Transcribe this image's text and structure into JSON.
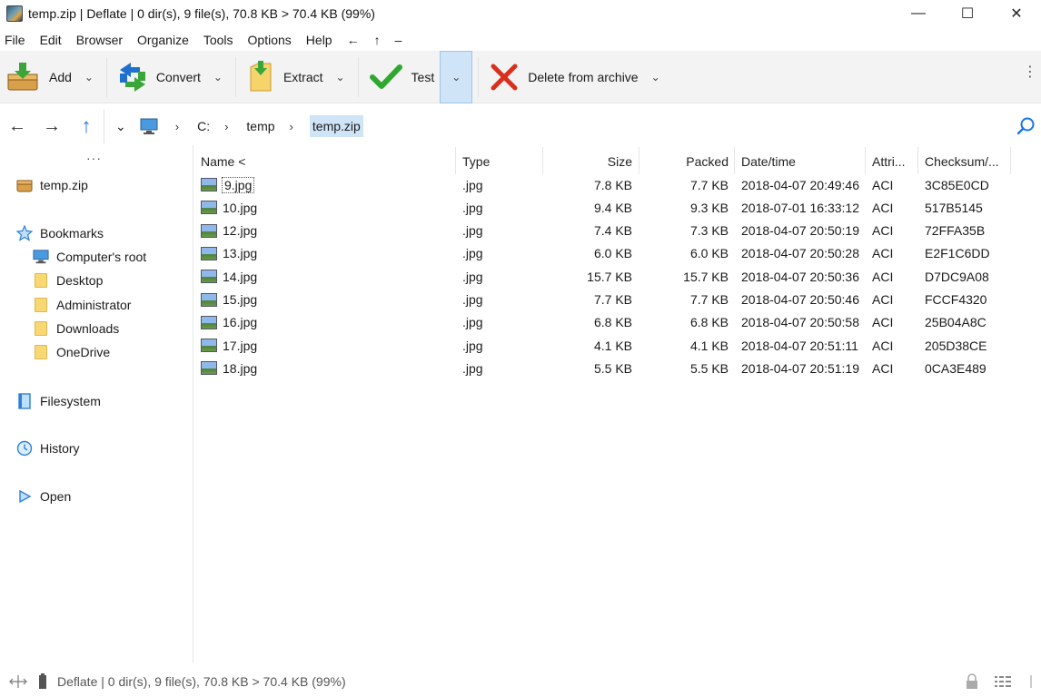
{
  "window": {
    "title": "temp.zip | Deflate | 0 dir(s), 9 file(s), 70.8 KB > 70.4 KB (99%)",
    "minimize": "—",
    "maximize": "☐",
    "close": "✕"
  },
  "menu": {
    "items": [
      "File",
      "Edit",
      "Browser",
      "Organize",
      "Tools",
      "Options",
      "Help",
      "←",
      "↑",
      "–"
    ]
  },
  "toolbar": {
    "add": "Add",
    "convert": "Convert",
    "extract": "Extract",
    "test": "Test",
    "delete": "Delete from archive",
    "dropdown": "⌄",
    "more": "⋮"
  },
  "address": {
    "back": "←",
    "forward": "→",
    "up": "↑",
    "history_dropdown": "⌄",
    "crumbs": [
      "C:",
      "temp",
      "temp.zip"
    ],
    "separator": "›"
  },
  "sidebar": {
    "dots": "···",
    "archive": "temp.zip",
    "bookmarks": "Bookmarks",
    "bookmark_items": [
      "Computer's root",
      "Desktop",
      "Administrator",
      "Downloads",
      "OneDrive"
    ],
    "filesystem": "Filesystem",
    "history": "History",
    "open": "Open"
  },
  "columns": {
    "name": "Name <",
    "type": "Type",
    "size": "Size",
    "packed": "Packed",
    "datetime": "Date/time",
    "attrib": "Attri...",
    "checksum": "Checksum/..."
  },
  "files": [
    {
      "name": "9.jpg",
      "type": ".jpg",
      "size": "7.8 KB",
      "packed": "7.7 KB",
      "datetime": "2018-04-07 20:49:46",
      "attrib": "ACI",
      "checksum": "3C85E0CD"
    },
    {
      "name": "10.jpg",
      "type": ".jpg",
      "size": "9.4 KB",
      "packed": "9.3 KB",
      "datetime": "2018-07-01 16:33:12",
      "attrib": "ACI",
      "checksum": "517B5145"
    },
    {
      "name": "12.jpg",
      "type": ".jpg",
      "size": "7.4 KB",
      "packed": "7.3 KB",
      "datetime": "2018-04-07 20:50:19",
      "attrib": "ACI",
      "checksum": "72FFA35B"
    },
    {
      "name": "13.jpg",
      "type": ".jpg",
      "size": "6.0 KB",
      "packed": "6.0 KB",
      "datetime": "2018-04-07 20:50:28",
      "attrib": "ACI",
      "checksum": "E2F1C6DD"
    },
    {
      "name": "14.jpg",
      "type": ".jpg",
      "size": "15.7 KB",
      "packed": "15.7 KB",
      "datetime": "2018-04-07 20:50:36",
      "attrib": "ACI",
      "checksum": "D7DC9A08"
    },
    {
      "name": "15.jpg",
      "type": ".jpg",
      "size": "7.7 KB",
      "packed": "7.7 KB",
      "datetime": "2018-04-07 20:50:46",
      "attrib": "ACI",
      "checksum": "FCCF4320"
    },
    {
      "name": "16.jpg",
      "type": ".jpg",
      "size": "6.8 KB",
      "packed": "6.8 KB",
      "datetime": "2018-04-07 20:50:58",
      "attrib": "ACI",
      "checksum": "25B04A8C"
    },
    {
      "name": "17.jpg",
      "type": ".jpg",
      "size": "4.1 KB",
      "packed": "4.1 KB",
      "datetime": "2018-04-07 20:51:11",
      "attrib": "ACI",
      "checksum": "205D38CE"
    },
    {
      "name": "18.jpg",
      "type": ".jpg",
      "size": "5.5 KB",
      "packed": "5.5 KB",
      "datetime": "2018-04-07 20:51:19",
      "attrib": "ACI",
      "checksum": "0CA3E489"
    }
  ],
  "status": {
    "text": "Deflate | 0 dir(s), 9 file(s), 70.8 KB > 70.4 KB (99%)"
  },
  "colors": {
    "accent": "#1a73e8",
    "selection": "#cfe4f7",
    "toolbar_bg": "#f3f3f3"
  }
}
